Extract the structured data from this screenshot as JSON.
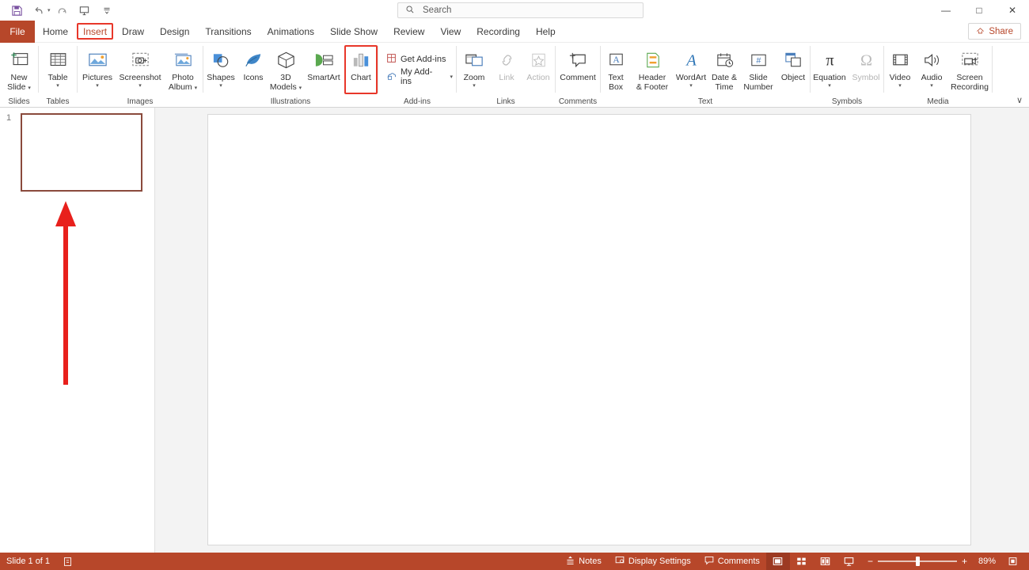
{
  "titlebar": {
    "quick_access": [
      {
        "name": "save-icon",
        "glyph": "💾"
      },
      {
        "name": "undo-icon",
        "glyph": "↶"
      },
      {
        "name": "undo-dropdown-caret-icon",
        "glyph": "▾"
      },
      {
        "name": "redo-icon",
        "glyph": "↻"
      },
      {
        "name": "start-presentation-icon",
        "glyph": "⬚"
      },
      {
        "name": "customize-qat-caret-icon",
        "glyph": "≔"
      }
    ],
    "search": {
      "placeholder": "Search",
      "icon": "search-icon"
    },
    "window_controls": [
      {
        "name": "minimize-button",
        "glyph": "—"
      },
      {
        "name": "maximize-button",
        "glyph": "□"
      },
      {
        "name": "close-button",
        "glyph": "✕"
      }
    ]
  },
  "tabs": {
    "file_label": "File",
    "items": [
      {
        "label": "Home",
        "active": false
      },
      {
        "label": "Insert",
        "active": true
      },
      {
        "label": "Draw",
        "active": false
      },
      {
        "label": "Design",
        "active": false
      },
      {
        "label": "Transitions",
        "active": false
      },
      {
        "label": "Animations",
        "active": false
      },
      {
        "label": "Slide Show",
        "active": false
      },
      {
        "label": "Review",
        "active": false
      },
      {
        "label": "View",
        "active": false
      },
      {
        "label": "Recording",
        "active": false
      },
      {
        "label": "Help",
        "active": false
      }
    ],
    "share_label": "Share"
  },
  "ribbon": {
    "collapse_caret": "∨",
    "groups": [
      {
        "label": "Slides",
        "buttons": [
          {
            "name": "new-slide-button",
            "label": "New\nSlide",
            "caret": true,
            "disabled": false
          }
        ]
      },
      {
        "label": "Tables",
        "buttons": [
          {
            "name": "table-button",
            "label": "Table",
            "caret": true,
            "disabled": false
          }
        ]
      },
      {
        "label": "Images",
        "buttons": [
          {
            "name": "pictures-button",
            "label": "Pictures",
            "caret": true,
            "disabled": false
          },
          {
            "name": "screenshot-button",
            "label": "Screenshot",
            "caret": true,
            "disabled": false
          },
          {
            "name": "photo-album-button",
            "label": "Photo\nAlbum",
            "caret": true,
            "disabled": false
          }
        ]
      },
      {
        "label": "Illustrations",
        "buttons": [
          {
            "name": "shapes-button",
            "label": "Shapes",
            "caret": true,
            "disabled": false
          },
          {
            "name": "icons-button",
            "label": "Icons",
            "caret": false,
            "disabled": false
          },
          {
            "name": "3d-models-button",
            "label": "3D\nModels",
            "caret": true,
            "disabled": false
          },
          {
            "name": "smartart-button",
            "label": "SmartArt",
            "caret": false,
            "disabled": false
          },
          {
            "name": "chart-button",
            "label": "Chart",
            "caret": false,
            "disabled": false,
            "highlighted": true
          }
        ]
      },
      {
        "label": "Add-ins",
        "buttons": [
          {
            "name": "get-add-ins-button",
            "label": "Get Add-ins",
            "small": true
          },
          {
            "name": "my-add-ins-button",
            "label": "My Add-ins",
            "small": true,
            "caret": true
          }
        ]
      },
      {
        "label": "Links",
        "buttons": [
          {
            "name": "zoom-button",
            "label": "Zoom",
            "caret": true,
            "disabled": false
          },
          {
            "name": "link-button",
            "label": "Link",
            "caret": false,
            "disabled": true
          },
          {
            "name": "action-button",
            "label": "Action",
            "caret": false,
            "disabled": true
          }
        ]
      },
      {
        "label": "Comments",
        "buttons": [
          {
            "name": "comment-button",
            "label": "Comment",
            "caret": false,
            "disabled": false
          }
        ]
      },
      {
        "label": "Text",
        "buttons": [
          {
            "name": "text-box-button",
            "label": "Text\nBox",
            "caret": false,
            "disabled": false
          },
          {
            "name": "header-footer-button",
            "label": "Header\n& Footer",
            "caret": false,
            "disabled": false
          },
          {
            "name": "wordart-button",
            "label": "WordArt",
            "caret": true,
            "disabled": false
          },
          {
            "name": "date-time-button",
            "label": "Date &\nTime",
            "caret": false,
            "disabled": false
          },
          {
            "name": "slide-number-button",
            "label": "Slide\nNumber",
            "caret": false,
            "disabled": false
          },
          {
            "name": "object-button",
            "label": "Object",
            "caret": false,
            "disabled": false
          }
        ]
      },
      {
        "label": "Symbols",
        "buttons": [
          {
            "name": "equation-button",
            "label": "Equation",
            "caret": true,
            "disabled": false
          },
          {
            "name": "symbol-button",
            "label": "Symbol",
            "caret": false,
            "disabled": true
          }
        ]
      },
      {
        "label": "Media",
        "buttons": [
          {
            "name": "video-button",
            "label": "Video",
            "caret": true,
            "disabled": false
          },
          {
            "name": "audio-button",
            "label": "Audio",
            "caret": true,
            "disabled": false
          },
          {
            "name": "screen-recording-button",
            "label": "Screen\nRecording",
            "caret": false,
            "disabled": false
          }
        ]
      }
    ]
  },
  "slide_panel": {
    "slide_number": "1"
  },
  "annotation": {
    "arrow_color": "#e8201c",
    "highlight_color": "#e8372a"
  },
  "statusbar": {
    "slide_indicator": "Slide 1 of 1",
    "accessibility_icon": "accessibility-checker-icon",
    "notes_label": "Notes",
    "display_settings_label": "Display Settings",
    "comments_label": "Comments",
    "views": [
      {
        "name": "normal-view-button",
        "active": true
      },
      {
        "name": "slide-sorter-view-button",
        "active": false
      },
      {
        "name": "reading-view-button",
        "active": false
      },
      {
        "name": "slide-show-button",
        "active": false
      }
    ],
    "zoom_out": "−",
    "zoom_in": "+",
    "zoom_percent": "89%",
    "fit_icon": "fit-slide-to-window-icon"
  }
}
